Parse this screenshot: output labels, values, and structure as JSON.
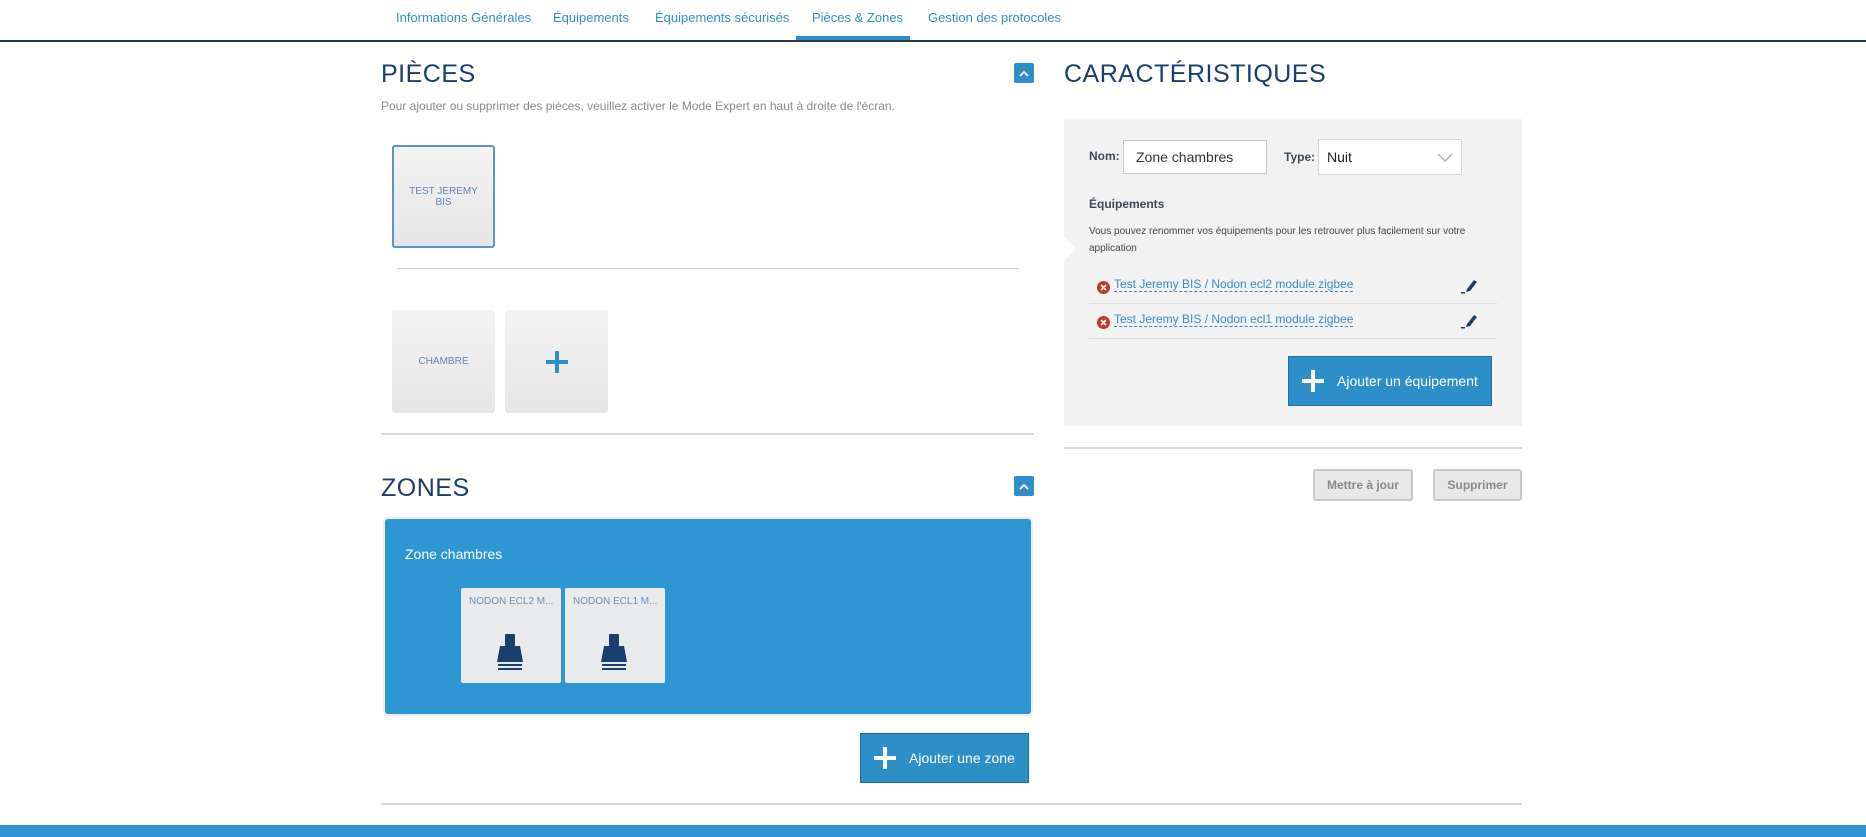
{
  "tabs": [
    {
      "label": "Informations Générales"
    },
    {
      "label": "Équipements"
    },
    {
      "label": "Équipements sécurisés"
    },
    {
      "label": "Pièces & Zones",
      "active": true
    },
    {
      "label": "Gestion des protocoles"
    }
  ],
  "pieces": {
    "title": "PIÈCES",
    "hint": "Pour ajouter ou supprimer des pièces, veuillez activer le Mode Expert en haut à droite de l'écran.",
    "selected_room": "TEST JEREMY BIS",
    "rooms": [
      "CHAMBRE"
    ]
  },
  "zones": {
    "title": "ZONES",
    "zone_name": "Zone chambres",
    "devices": [
      {
        "label": "NODON ECL2 M...",
        "icon": "bulb-icon"
      },
      {
        "label": "NODON ECL1 M...",
        "icon": "bulb-icon"
      }
    ],
    "add_zone_label": "Ajouter une zone"
  },
  "caracteristiques": {
    "title": "CARACTÉRISTIQUES",
    "nom_label": "Nom:",
    "nom_value": "Zone chambres",
    "type_label": "Type:",
    "type_value": "Nuit",
    "equipements_label": "Équipements",
    "equipements_hint": "Vous pouvez renommer vos équipements pour les retrouver plus facilement sur votre application",
    "equipements": [
      {
        "name": "Test Jeremy BIS / Nodon ecl2 module zigbee"
      },
      {
        "name": "Test Jeremy BIS / Nodon ecl1 module zigbee"
      }
    ],
    "add_equipment_label": "Ajouter un équipement",
    "update_label": "Mettre à jour",
    "delete_label": "Supprimer"
  },
  "colors": {
    "accent": "#2e8fc8",
    "zone_bg": "#2e96d3",
    "title": "#1a3e6e",
    "remove": "#c0392b"
  }
}
